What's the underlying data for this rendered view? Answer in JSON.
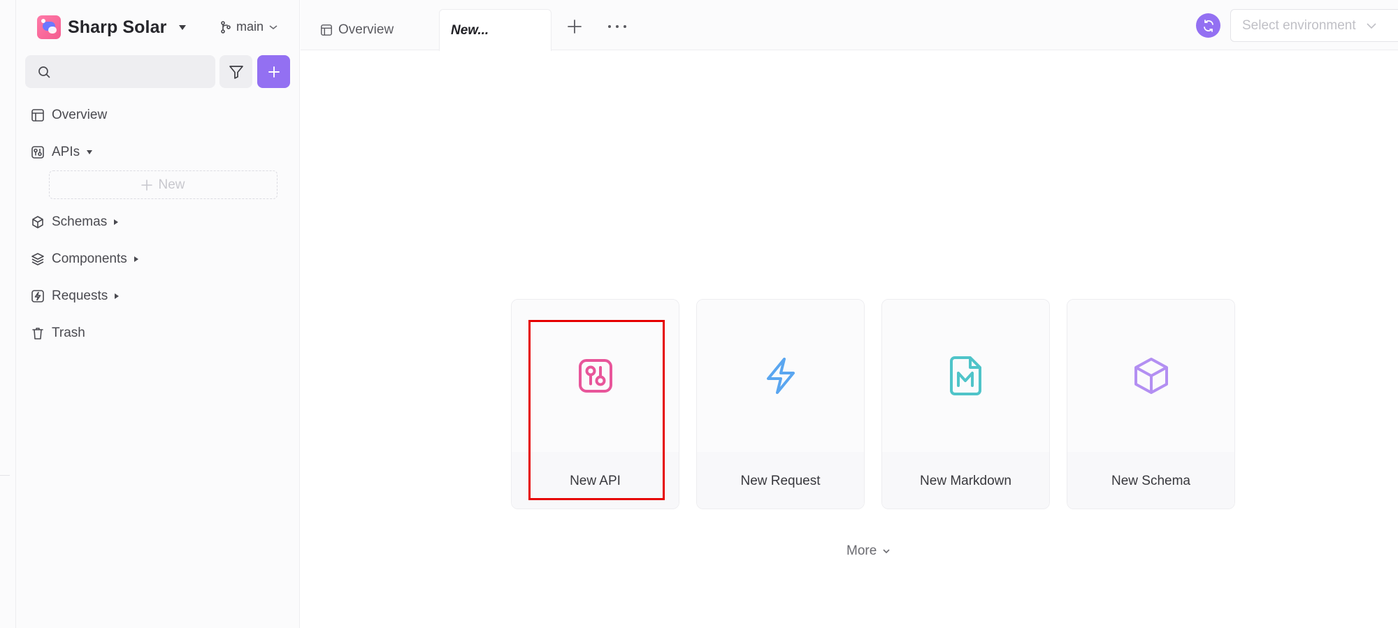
{
  "sidebar": {
    "project_name": "Sharp Solar",
    "branch": "main",
    "search_placeholder": "",
    "nav": {
      "overview": "Overview",
      "apis": "APIs",
      "apis_new": "New",
      "schemas": "Schemas",
      "components": "Components",
      "requests": "Requests",
      "trash": "Trash"
    }
  },
  "tabs": {
    "overview": "Overview",
    "new": "New..."
  },
  "header": {
    "env_placeholder": "Select environment"
  },
  "cards": {
    "new_api": "New API",
    "new_request": "New Request",
    "new_markdown": "New Markdown",
    "new_schema": "New Schema"
  },
  "more_label": "More",
  "colors": {
    "accent": "#9370f2",
    "api": "#e8559a",
    "request": "#5aa6f0",
    "markdown": "#4fc4c9",
    "schema": "#b38ff2",
    "highlight": "#e60000"
  }
}
